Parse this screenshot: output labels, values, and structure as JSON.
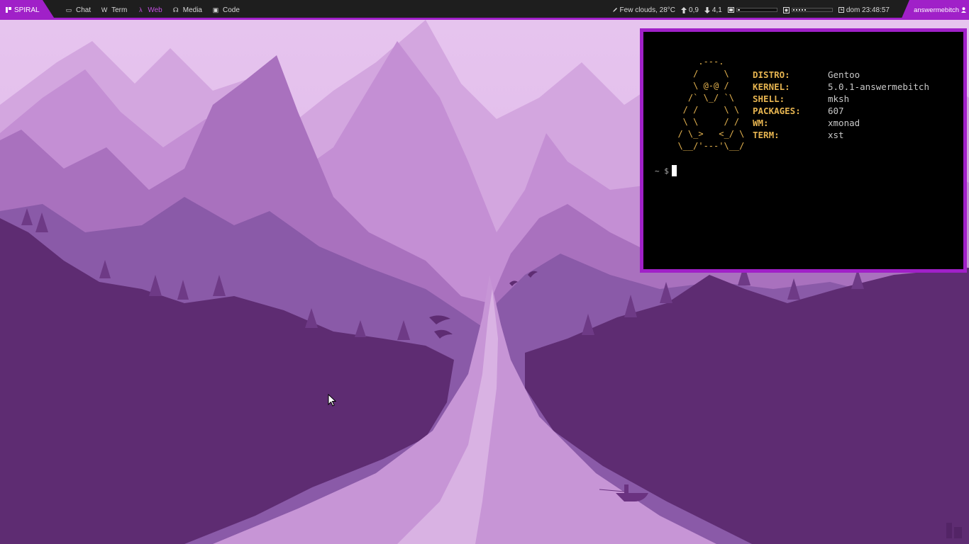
{
  "bar": {
    "logo_label": "SPIRAL",
    "workspaces": [
      {
        "label": "Chat",
        "icon": "chat-icon",
        "glyph": "▭"
      },
      {
        "label": "Term",
        "icon": "term-icon",
        "glyph": "W"
      },
      {
        "label": "Web",
        "icon": "web-icon",
        "glyph": "λ"
      },
      {
        "label": "Media",
        "icon": "media-icon",
        "glyph": "☊"
      },
      {
        "label": "Code",
        "icon": "code-icon",
        "glyph": "▣"
      }
    ],
    "active_workspace": "Web",
    "weather": "Few clouds, 28°C",
    "upload": "0,9",
    "download": "4,1",
    "volume_level": 0.06,
    "brightness_level": 0.35,
    "clock": "dom 23:48:57",
    "user": "answermebitch"
  },
  "colors": {
    "accent": "#a020c8",
    "bar_bg": "#1e1e1e",
    "ascii": "#e6b450",
    "terminal_bg": "#000000"
  },
  "terminal": {
    "ascii_art": "      .---.\n     /     \\\n     \\ @-@ /\n    /` \\_/ `\\\n   / /     \\ \\\n   \\ \\     / /\n  / \\_>   <_/ \\\n  \\__/'---'\\__/",
    "info": [
      {
        "key": "DISTRO:",
        "value": "Gentoo"
      },
      {
        "key": "KERNEL:",
        "value": "5.0.1-answermebitch"
      },
      {
        "key": "SHELL:",
        "value": "mksh"
      },
      {
        "key": "PACKAGES:",
        "value": "607"
      },
      {
        "key": "WM:",
        "value": "xmonad"
      },
      {
        "key": "TERM:",
        "value": "xst"
      }
    ],
    "prompt": "~ $"
  }
}
